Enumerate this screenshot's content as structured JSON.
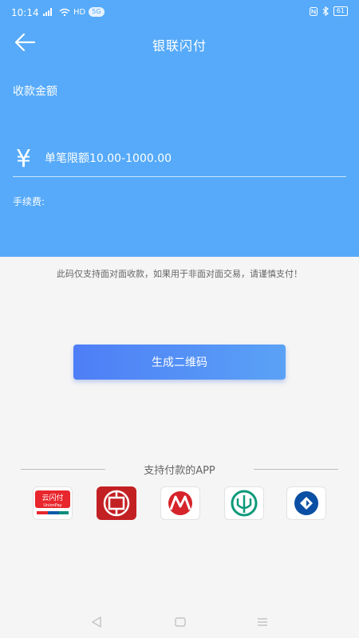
{
  "status_bar": {
    "time": "10:14",
    "network": "HD",
    "badge": "5G",
    "battery": "61"
  },
  "header": {
    "title": "银联闪付"
  },
  "amount": {
    "label": "收款金额",
    "currency_symbol": "¥",
    "placeholder": "单笔限额10.00-1000.00",
    "value": ""
  },
  "fee": {
    "label": "手续费:"
  },
  "notice": "此码仅支持面对面收款，如果用于非面对面交易，请谨慎支付！",
  "generate_button": "生成二维码",
  "apps_section": {
    "title": "支持付款的APP",
    "apps": [
      {
        "icon": "cloud-quickpass-icon",
        "text_main": "云闪付",
        "text_sub": "UnionPay"
      },
      {
        "icon": "icbc-icon"
      },
      {
        "icon": "cmb-icon"
      },
      {
        "icon": "abc-icon"
      },
      {
        "icon": "ccb-icon"
      }
    ]
  },
  "colors": {
    "header_bg": "#56aaf9",
    "button_start": "#4e7ef6",
    "button_end": "#5aa2f6",
    "page_bg": "#f5f5f5"
  }
}
